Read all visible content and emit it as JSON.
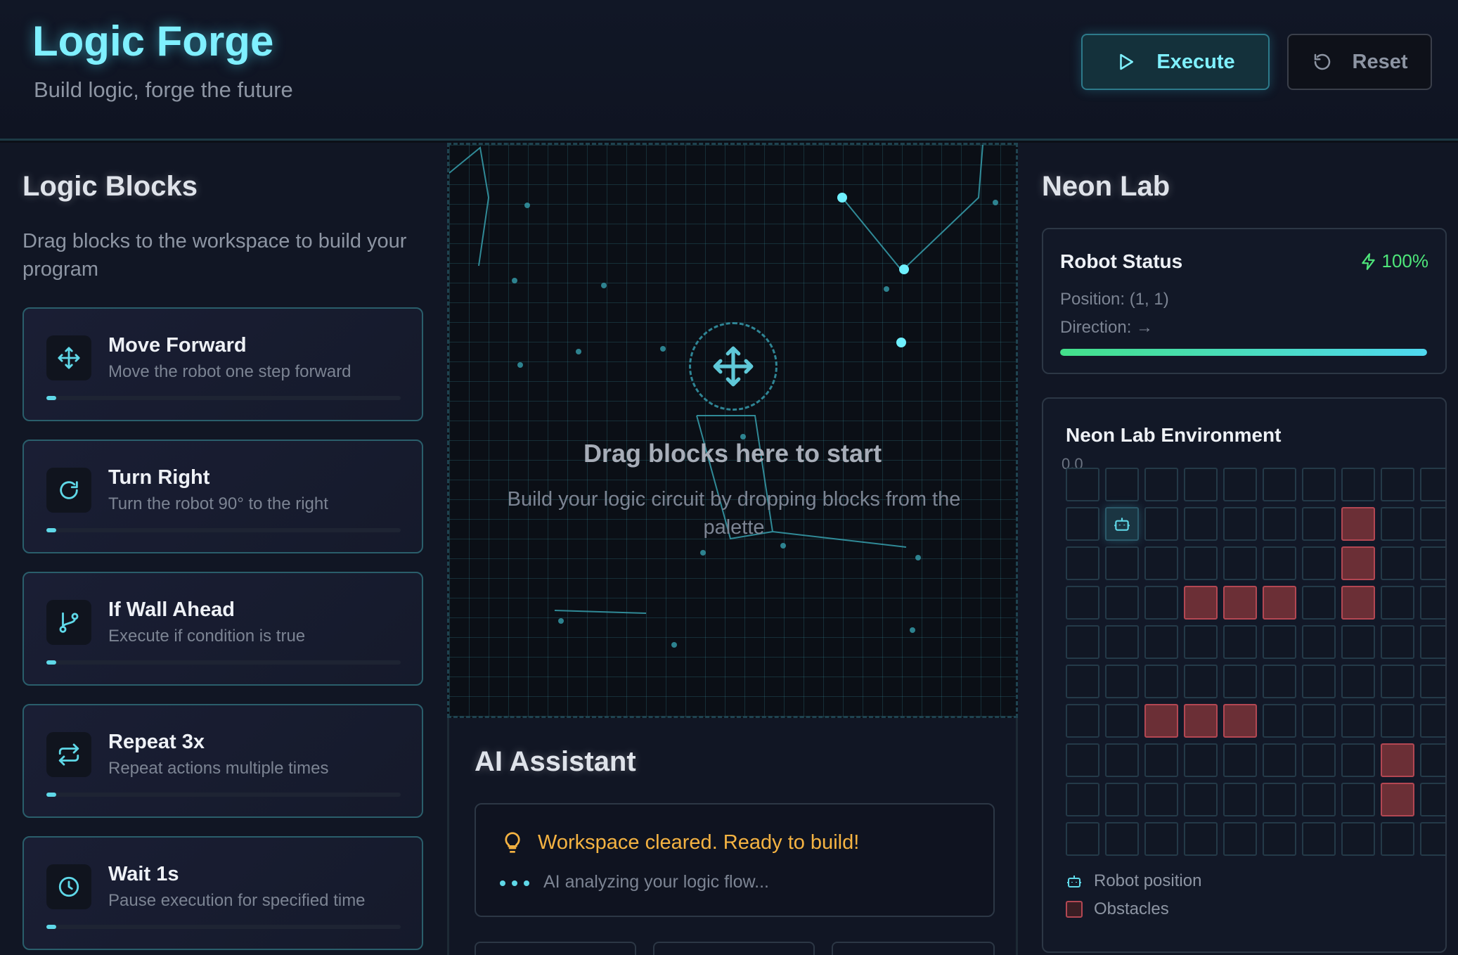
{
  "app": {
    "title": "Logic Forge",
    "subtitle": "Build logic, forge the future"
  },
  "toolbar": {
    "execute_label": "Execute",
    "execute_icon": "play-icon",
    "reset_label": "Reset",
    "reset_icon": "reset-icon"
  },
  "palette": {
    "title": "Logic Blocks",
    "description": "Drag blocks to the workspace to build your program",
    "blocks": [
      {
        "name": "Move Forward",
        "description": "Move the robot one step forward",
        "icon": "move-icon"
      },
      {
        "name": "Turn Right",
        "description": "Turn the robot 90° to the right",
        "icon": "rotate-icon"
      },
      {
        "name": "If Wall Ahead",
        "description": "Execute if condition is true",
        "icon": "branch-icon"
      },
      {
        "name": "Repeat 3x",
        "description": "Repeat actions multiple times",
        "icon": "repeat-icon"
      },
      {
        "name": "Wait 1s",
        "description": "Pause execution for specified time",
        "icon": "clock-icon"
      }
    ]
  },
  "workspace": {
    "drop_title": "Drag blocks here to start",
    "drop_subtitle": "Build your logic circuit by dropping blocks from the palette"
  },
  "assistant": {
    "title": "AI Assistant",
    "message": "Workspace cleared. Ready to build!",
    "status": "AI analyzing your logic flow..."
  },
  "lab": {
    "title": "Neon Lab",
    "status_title": "Robot Status",
    "battery": "100%",
    "battery_level": 1.0,
    "position": "Position: (1, 1)",
    "direction": "Direction: →",
    "env_title": "Neon Lab Environment",
    "origin_label": "0,0",
    "legend_robot": "Robot position",
    "legend_obstacles": "Obstacles",
    "grid_cols": 11,
    "grid_rows": 10,
    "robot": [
      1,
      1
    ],
    "obstacles": [
      [
        7,
        1
      ],
      [
        7,
        2
      ],
      [
        3,
        3
      ],
      [
        4,
        3
      ],
      [
        5,
        3
      ],
      [
        7,
        3
      ],
      [
        2,
        6
      ],
      [
        3,
        6
      ],
      [
        4,
        6
      ],
      [
        8,
        7
      ],
      [
        8,
        8
      ]
    ]
  },
  "colors": {
    "accent": "#7ff0ff",
    "obstacle": "#6b2f36",
    "warning": "#f5b342",
    "battery": "#4ee67a"
  }
}
